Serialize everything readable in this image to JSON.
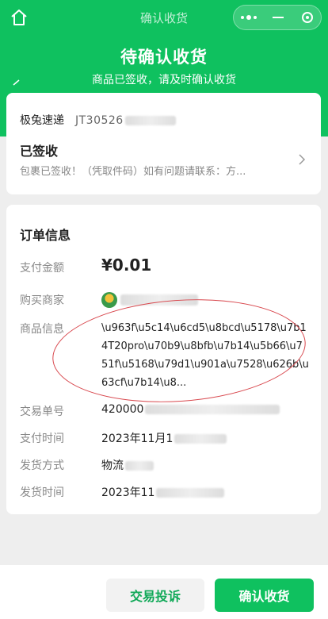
{
  "colors": {
    "brand_green": "#0fc15f",
    "annotation_red": "#d8474d"
  },
  "topbar": {
    "title": "确认收货",
    "icons": [
      "home-icon",
      "more-dots-icon",
      "minimize-icon",
      "close-target-icon"
    ]
  },
  "hero": {
    "title": "待确认收货",
    "subtitle": "商品已签收，请及时确认收货"
  },
  "logistics": {
    "courier_name": "极兔速递",
    "tracking_number_visible": "JT30526",
    "status": "已签收",
    "description": "包裹已签收！（凭取件码）如有问题请联系：方..."
  },
  "order": {
    "section_title": "订单信息",
    "rows": {
      "amount": {
        "label": "支付金额",
        "value": "¥0.01"
      },
      "merchant": {
        "label": "购买商家",
        "value": ""
      },
      "goods": {
        "label": "商品信息",
        "value": "\\u963f\\u5c14\\u6cd5\\u8bcd\\u5178\\u7b14T20pro\\u70b9\\u8bfb\\u7b14\\u5b66\\u751f\\u5168\\u79d1\\u901a\\u7528\\u626b\\u63cf\\u7b14\\u8..."
      },
      "trade_no": {
        "label": "交易单号",
        "value": "420000"
      },
      "pay_time": {
        "label": "支付时间",
        "value": "2023年11月1"
      },
      "ship_method": {
        "label": "发货方式",
        "value": "物流"
      },
      "ship_time": {
        "label": "发货时间",
        "value": "2023年11"
      }
    }
  },
  "actions": {
    "complain": "交易投诉",
    "confirm": "确认收货"
  }
}
